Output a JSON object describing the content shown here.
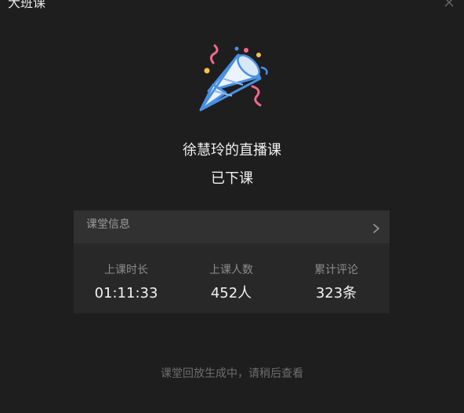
{
  "window": {
    "title": "大班课"
  },
  "icons": {
    "party": "party-popper-icon",
    "close": "close-icon",
    "chevron": "chevron-right-icon"
  },
  "course": {
    "name": "徐慧玲的直播课",
    "status": "已下课"
  },
  "info": {
    "header_label": "课堂信息",
    "stats": [
      {
        "label": "上课时长",
        "value": "01:11:33"
      },
      {
        "label": "上课人数",
        "value": "452人"
      },
      {
        "label": "累计评论",
        "value": "323条"
      }
    ]
  },
  "footer": {
    "note": "课堂回放生成中，请稍后查看"
  },
  "colors": {
    "background": "#1e1e1f",
    "card": "#282829",
    "card_header": "#313132",
    "popper_blue": "#4a90e2",
    "confetti_pink": "#f06a8a",
    "confetti_yellow": "#f5c24a"
  }
}
